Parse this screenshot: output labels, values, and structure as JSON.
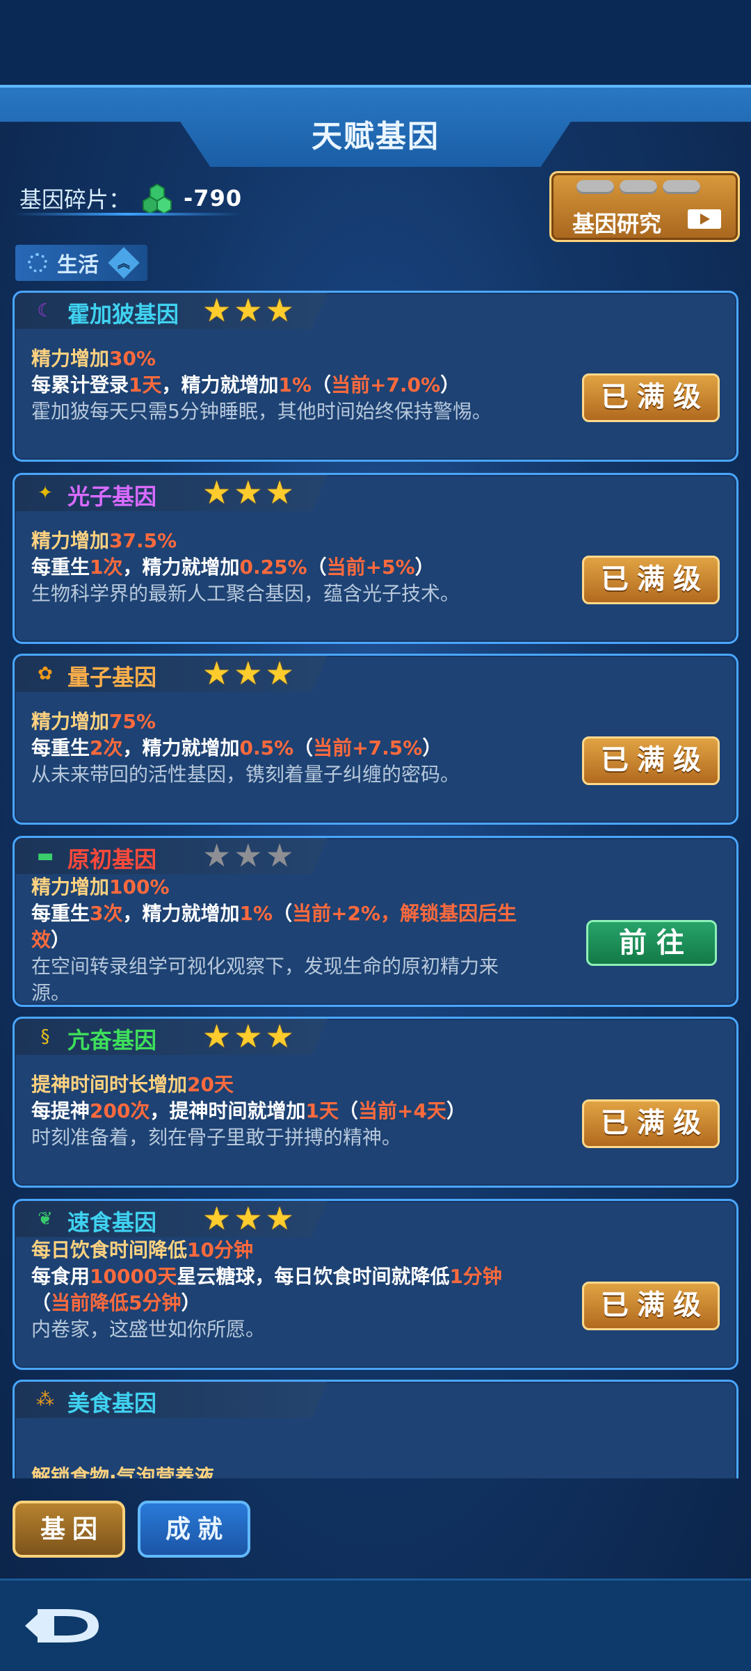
{
  "header": {
    "title": "天赋基因"
  },
  "fragments": {
    "label": "基因碎片：",
    "value": "-790"
  },
  "research_button": {
    "label": "基因研究"
  },
  "filter": {
    "label": "生活"
  },
  "genes": [
    {
      "name": "霍加狓基因",
      "name_color": "#3fd2f0",
      "icon": "horn-icon",
      "icon_color": "#9b3dd6",
      "stars": 3,
      "l1": [
        [
          "t",
          "精力增加"
        ],
        [
          "h",
          "30%"
        ]
      ],
      "l2": [
        [
          "t",
          "每累计登录"
        ],
        [
          "h",
          "1天"
        ],
        [
          "t",
          "，精力就增加"
        ],
        [
          "h",
          "1%"
        ],
        [
          "t",
          "（"
        ],
        [
          "h",
          "当前+7.0%"
        ],
        [
          "t",
          "）"
        ]
      ],
      "l3": "霍加狓每天只需5分钟睡眠，其他时间始终保持警惕。",
      "button": "已满级",
      "button_type": "max"
    },
    {
      "name": "光子基因",
      "name_color": "#d86bff",
      "icon": "molecule-icon",
      "icon_color": "#e3b800",
      "stars": 3,
      "l1": [
        [
          "t",
          "精力增加"
        ],
        [
          "h",
          "37.5%"
        ]
      ],
      "l2": [
        [
          "t",
          "每重生"
        ],
        [
          "h",
          "1次"
        ],
        [
          "t",
          "，精力就增加"
        ],
        [
          "h",
          "0.25%"
        ],
        [
          "t",
          "（"
        ],
        [
          "h",
          "当前+5%"
        ],
        [
          "t",
          "）"
        ]
      ],
      "l3": "生物科学界的最新人工聚合基因，蕴含光子技术。",
      "button": "已满级",
      "button_type": "max"
    },
    {
      "name": "量子基因",
      "name_color": "#ffb04a",
      "icon": "flower-icon",
      "icon_color": "#f29a1a",
      "stars": 3,
      "l1": [
        [
          "t",
          "精力增加"
        ],
        [
          "h",
          "75%"
        ]
      ],
      "l2": [
        [
          "t",
          "每重生"
        ],
        [
          "h",
          "2次"
        ],
        [
          "t",
          "，精力就增加"
        ],
        [
          "h",
          "0.5%"
        ],
        [
          "t",
          "（"
        ],
        [
          "h",
          "当前+7.5%"
        ],
        [
          "t",
          "）"
        ]
      ],
      "l3": "从未来带回的活性基因，镌刻着量子纠缠的密码。",
      "button": "已满级",
      "button_type": "max"
    },
    {
      "name": "原初基因",
      "name_color": "#ff4a3a",
      "icon": "ruler-icon",
      "icon_color": "#3bcf6b",
      "stars": 0,
      "l1": [
        [
          "t",
          "精力增加"
        ],
        [
          "h",
          "100%"
        ]
      ],
      "l2": [
        [
          "t",
          "每重生"
        ],
        [
          "h",
          "3次"
        ],
        [
          "t",
          "，精力就增加"
        ],
        [
          "h",
          "1%"
        ],
        [
          "t",
          "（"
        ],
        [
          "h",
          "当前+2%，解锁基因后生效"
        ],
        [
          "t",
          "）"
        ]
      ],
      "l3": "在空间转录组学可视化观察下，发现生命的原初精力来源。",
      "button": "前往",
      "button_type": "go"
    },
    {
      "name": "亢奋基因",
      "name_color": "#3ee05a",
      "icon": "dna-icon",
      "icon_color": "#e8c21a",
      "stars": 3,
      "l1": [
        [
          "t",
          "提神时间时长增加"
        ],
        [
          "h",
          "20天"
        ]
      ],
      "l2": [
        [
          "t",
          "每提神"
        ],
        [
          "h",
          "200次"
        ],
        [
          "t",
          "，提神时间就增加"
        ],
        [
          "h",
          "1天"
        ],
        [
          "t",
          "（"
        ],
        [
          "h",
          "当前+4天"
        ],
        [
          "t",
          "）"
        ]
      ],
      "l3": "时刻准备着，刻在骨子里敢于拼搏的精神。",
      "button": "已满级",
      "button_type": "max"
    },
    {
      "name": "速食基因",
      "name_color": "#3fd2f0",
      "icon": "leaf-dna-icon",
      "icon_color": "#37c96b",
      "stars": 3,
      "l1": [
        [
          "t",
          "每日饮食时间降低"
        ],
        [
          "h",
          "10分钟"
        ]
      ],
      "l2": [
        [
          "t",
          "每食用"
        ],
        [
          "h",
          "10000天"
        ],
        [
          "t",
          "星云糖球，每日饮食时间就降低"
        ],
        [
          "h",
          "1分钟"
        ],
        [
          "t",
          "（"
        ],
        [
          "h",
          "当前降低5分钟"
        ],
        [
          "t",
          "）"
        ]
      ],
      "l3": "内卷家，这盛世如你所愿。",
      "button": "已满级",
      "button_type": "max"
    },
    {
      "name": "美食基因",
      "name_color": "#3fd2f0",
      "icon": "food-icon",
      "icon_color": "#f0a020",
      "stars": -1,
      "l1": [
        [
          "t",
          "解锁食物·气泡营养液"
        ]
      ],
      "l2": [],
      "l3": "",
      "button": "",
      "button_type": "max"
    }
  ],
  "tabs": {
    "gene": "基因",
    "achievement": "成就"
  }
}
